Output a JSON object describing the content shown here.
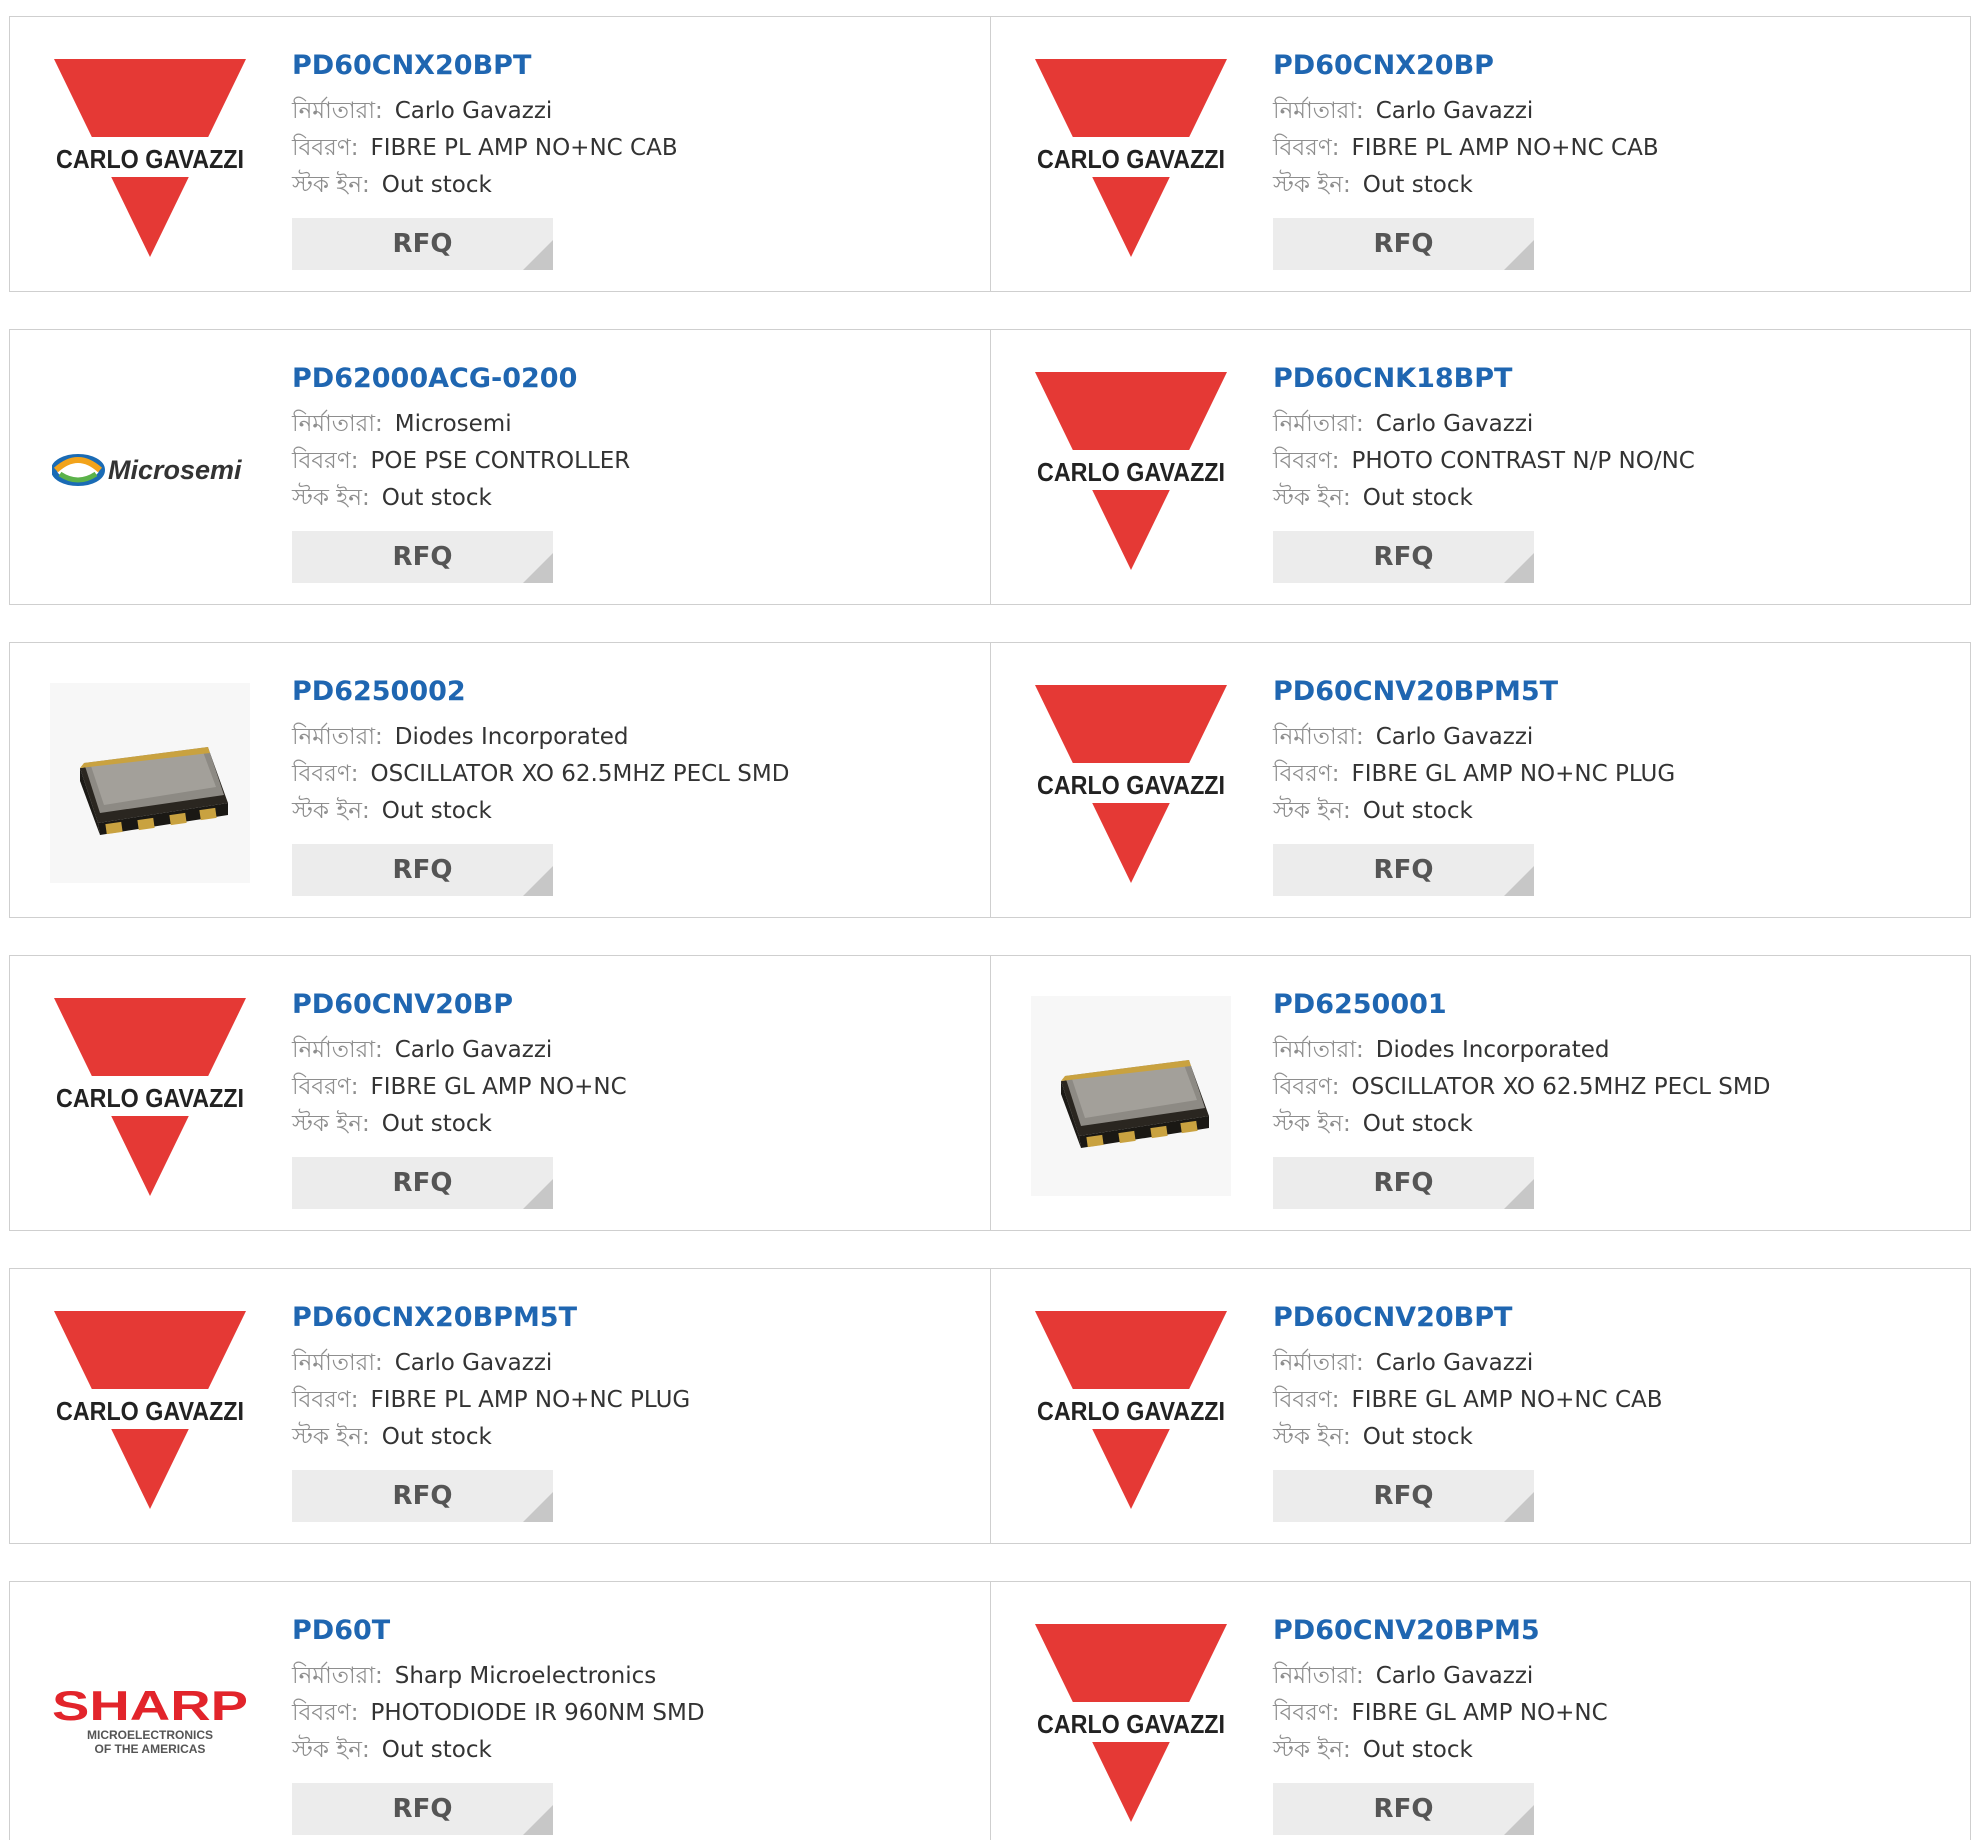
{
  "labels": {
    "manufacturer": "নির্মাতারা:",
    "description": "বিবরণ:",
    "stock": "স্টক ইন:"
  },
  "rfq_label": "RFQ",
  "logo_text": {
    "carlo": "CARLO GAVAZZI",
    "microsemi": "Microsemi",
    "sharp": "SHARP",
    "sharp_sub1": "MICROELECTRONICS",
    "sharp_sub2": "OF THE AMERICAS"
  },
  "colors": {
    "part_link": "#1f66b1",
    "carlo_red": "#e53935",
    "sharp_red": "#e2242b",
    "rfq_bg": "#ececec"
  },
  "products": [
    {
      "part": "PD60CNX20BPT",
      "logo": "carlo",
      "manufacturer": "Carlo Gavazzi",
      "description": "FIBRE PL AMP NO+NC CAB",
      "stock": "Out stock"
    },
    {
      "part": "PD60CNX20BP",
      "logo": "carlo",
      "manufacturer": "Carlo Gavazzi",
      "description": "FIBRE PL AMP NO+NC CAB",
      "stock": "Out stock"
    },
    {
      "part": "PD62000ACG-0200",
      "logo": "microsemi",
      "manufacturer": "Microsemi",
      "description": "POE PSE CONTROLLER",
      "stock": "Out stock"
    },
    {
      "part": "PD60CNK18BPT",
      "logo": "carlo",
      "manufacturer": "Carlo Gavazzi",
      "description": "PHOTO CONTRAST N/P NO/NC",
      "stock": "Out stock"
    },
    {
      "part": "PD6250002",
      "logo": "chip",
      "manufacturer": "Diodes Incorporated",
      "description": "OSCILLATOR XO 62.5MHZ PECL SMD",
      "stock": "Out stock"
    },
    {
      "part": "PD60CNV20BPM5T",
      "logo": "carlo",
      "manufacturer": "Carlo Gavazzi",
      "description": "FIBRE GL AMP NO+NC PLUG",
      "stock": "Out stock"
    },
    {
      "part": "PD60CNV20BP",
      "logo": "carlo",
      "manufacturer": "Carlo Gavazzi",
      "description": "FIBRE GL AMP NO+NC",
      "stock": "Out stock"
    },
    {
      "part": "PD6250001",
      "logo": "chip",
      "manufacturer": "Diodes Incorporated",
      "description": "OSCILLATOR XO 62.5MHZ PECL SMD",
      "stock": "Out stock"
    },
    {
      "part": "PD60CNX20BPM5T",
      "logo": "carlo",
      "manufacturer": "Carlo Gavazzi",
      "description": "FIBRE PL AMP NO+NC PLUG",
      "stock": "Out stock"
    },
    {
      "part": "PD60CNV20BPT",
      "logo": "carlo",
      "manufacturer": "Carlo Gavazzi",
      "description": "FIBRE GL AMP NO+NC CAB",
      "stock": "Out stock"
    },
    {
      "part": "PD60T",
      "logo": "sharp",
      "manufacturer": "Sharp Microelectronics",
      "description": "PHOTODIODE IR 960NM SMD",
      "stock": "Out stock"
    },
    {
      "part": "PD60CNV20BPM5",
      "logo": "carlo",
      "manufacturer": "Carlo Gavazzi",
      "description": "FIBRE GL AMP NO+NC",
      "stock": "Out stock"
    }
  ]
}
